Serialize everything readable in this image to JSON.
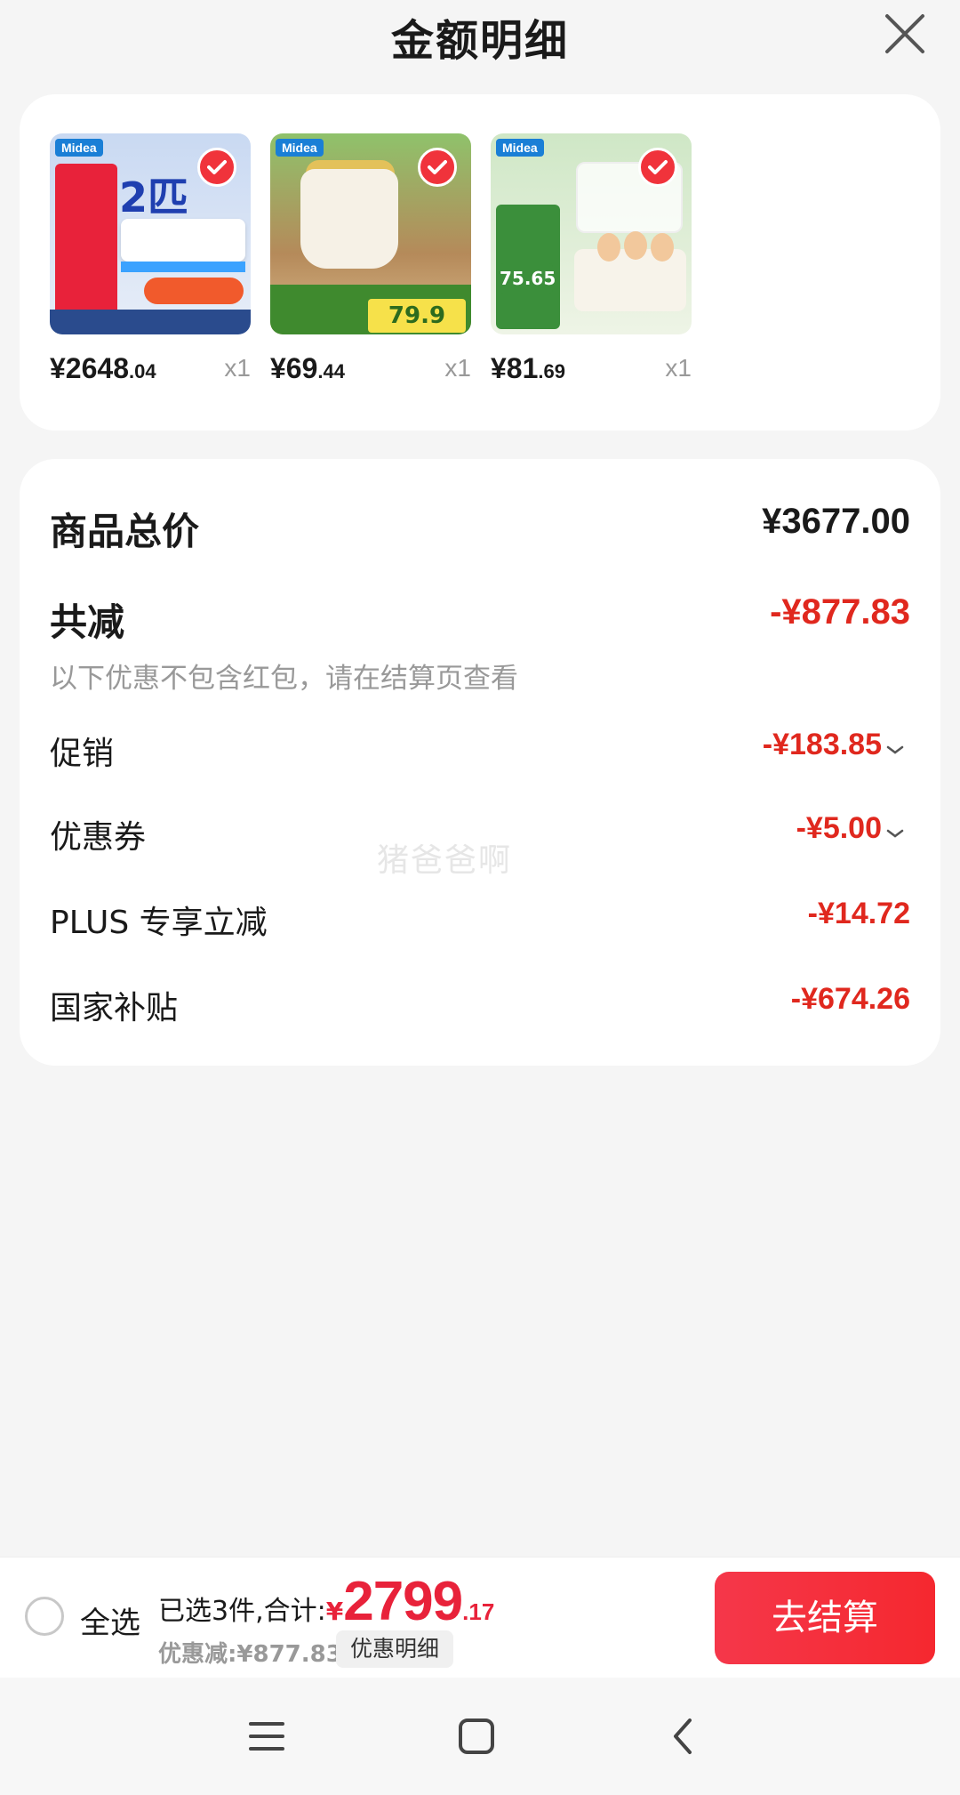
{
  "header": {
    "title": "金额明细",
    "close_icon": "close-icon"
  },
  "products": [
    {
      "price_int": "¥2648",
      "price_dec": ".04",
      "qty": "x1",
      "thumb_big_text": "2匹",
      "brand": "Midea"
    },
    {
      "price_int": "¥69",
      "price_dec": ".44",
      "qty": "x1",
      "thumb_text": "79.9",
      "brand": "Midea"
    },
    {
      "price_int": "¥81",
      "price_dec": ".69",
      "qty": "x1",
      "thumb_text": "75.65",
      "brand": "Midea"
    }
  ],
  "summary": {
    "total_label": "商品总价",
    "total_value": "¥3677.00",
    "reduce_label": "共减",
    "reduce_value": "-¥877.83",
    "reduce_note": "以下优惠不包含红包，请在结算页查看",
    "items": [
      {
        "label": "促销",
        "value": "-¥183.85"
      },
      {
        "label": "优惠券",
        "value": "-¥5.00"
      },
      {
        "label": "PLUS 专享立减",
        "value": "-¥14.72"
      },
      {
        "label": "国家补贴",
        "value": "-¥674.26"
      }
    ]
  },
  "watermark": "猪爸爸啊",
  "bottom_bar": {
    "select_all": "全选",
    "selected_text": "已选3件,合计:",
    "currency": "¥",
    "total_int": "2799",
    "total_dec": ".17",
    "discount_text": "优惠减:¥877.83",
    "detail_button": "优惠明细",
    "checkout_button": "去结算"
  },
  "colors": {
    "accent": "#e8223a",
    "discount": "#e0281e",
    "background": "#f5f5f5"
  }
}
